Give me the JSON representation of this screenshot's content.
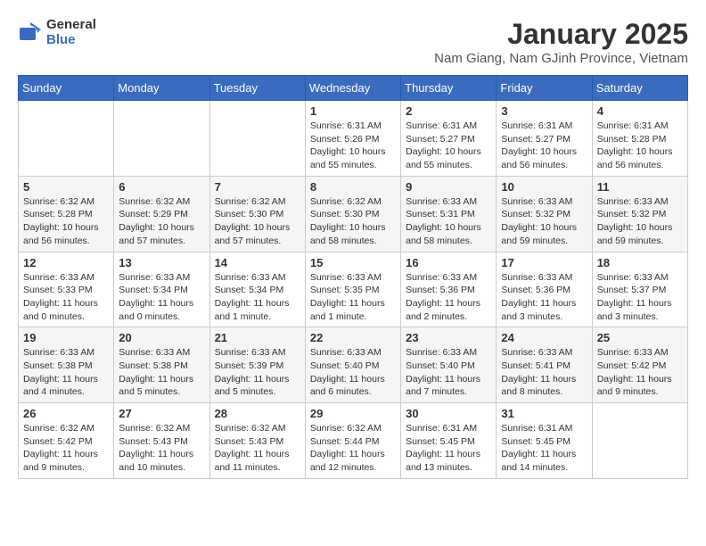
{
  "logo": {
    "general": "General",
    "blue": "Blue"
  },
  "title": {
    "month": "January 2025",
    "location": "Nam Giang, Nam GJinh Province, Vietnam"
  },
  "headers": [
    "Sunday",
    "Monday",
    "Tuesday",
    "Wednesday",
    "Thursday",
    "Friday",
    "Saturday"
  ],
  "weeks": [
    [
      {
        "day": "",
        "info": ""
      },
      {
        "day": "",
        "info": ""
      },
      {
        "day": "",
        "info": ""
      },
      {
        "day": "1",
        "info": "Sunrise: 6:31 AM\nSunset: 5:26 PM\nDaylight: 10 hours\nand 55 minutes."
      },
      {
        "day": "2",
        "info": "Sunrise: 6:31 AM\nSunset: 5:27 PM\nDaylight: 10 hours\nand 55 minutes."
      },
      {
        "day": "3",
        "info": "Sunrise: 6:31 AM\nSunset: 5:27 PM\nDaylight: 10 hours\nand 56 minutes."
      },
      {
        "day": "4",
        "info": "Sunrise: 6:31 AM\nSunset: 5:28 PM\nDaylight: 10 hours\nand 56 minutes."
      }
    ],
    [
      {
        "day": "5",
        "info": "Sunrise: 6:32 AM\nSunset: 5:28 PM\nDaylight: 10 hours\nand 56 minutes."
      },
      {
        "day": "6",
        "info": "Sunrise: 6:32 AM\nSunset: 5:29 PM\nDaylight: 10 hours\nand 57 minutes."
      },
      {
        "day": "7",
        "info": "Sunrise: 6:32 AM\nSunset: 5:30 PM\nDaylight: 10 hours\nand 57 minutes."
      },
      {
        "day": "8",
        "info": "Sunrise: 6:32 AM\nSunset: 5:30 PM\nDaylight: 10 hours\nand 58 minutes."
      },
      {
        "day": "9",
        "info": "Sunrise: 6:33 AM\nSunset: 5:31 PM\nDaylight: 10 hours\nand 58 minutes."
      },
      {
        "day": "10",
        "info": "Sunrise: 6:33 AM\nSunset: 5:32 PM\nDaylight: 10 hours\nand 59 minutes."
      },
      {
        "day": "11",
        "info": "Sunrise: 6:33 AM\nSunset: 5:32 PM\nDaylight: 10 hours\nand 59 minutes."
      }
    ],
    [
      {
        "day": "12",
        "info": "Sunrise: 6:33 AM\nSunset: 5:33 PM\nDaylight: 11 hours\nand 0 minutes."
      },
      {
        "day": "13",
        "info": "Sunrise: 6:33 AM\nSunset: 5:34 PM\nDaylight: 11 hours\nand 0 minutes."
      },
      {
        "day": "14",
        "info": "Sunrise: 6:33 AM\nSunset: 5:34 PM\nDaylight: 11 hours\nand 1 minute."
      },
      {
        "day": "15",
        "info": "Sunrise: 6:33 AM\nSunset: 5:35 PM\nDaylight: 11 hours\nand 1 minute."
      },
      {
        "day": "16",
        "info": "Sunrise: 6:33 AM\nSunset: 5:36 PM\nDaylight: 11 hours\nand 2 minutes."
      },
      {
        "day": "17",
        "info": "Sunrise: 6:33 AM\nSunset: 5:36 PM\nDaylight: 11 hours\nand 3 minutes."
      },
      {
        "day": "18",
        "info": "Sunrise: 6:33 AM\nSunset: 5:37 PM\nDaylight: 11 hours\nand 3 minutes."
      }
    ],
    [
      {
        "day": "19",
        "info": "Sunrise: 6:33 AM\nSunset: 5:38 PM\nDaylight: 11 hours\nand 4 minutes."
      },
      {
        "day": "20",
        "info": "Sunrise: 6:33 AM\nSunset: 5:38 PM\nDaylight: 11 hours\nand 5 minutes."
      },
      {
        "day": "21",
        "info": "Sunrise: 6:33 AM\nSunset: 5:39 PM\nDaylight: 11 hours\nand 5 minutes."
      },
      {
        "day": "22",
        "info": "Sunrise: 6:33 AM\nSunset: 5:40 PM\nDaylight: 11 hours\nand 6 minutes."
      },
      {
        "day": "23",
        "info": "Sunrise: 6:33 AM\nSunset: 5:40 PM\nDaylight: 11 hours\nand 7 minutes."
      },
      {
        "day": "24",
        "info": "Sunrise: 6:33 AM\nSunset: 5:41 PM\nDaylight: 11 hours\nand 8 minutes."
      },
      {
        "day": "25",
        "info": "Sunrise: 6:33 AM\nSunset: 5:42 PM\nDaylight: 11 hours\nand 9 minutes."
      }
    ],
    [
      {
        "day": "26",
        "info": "Sunrise: 6:32 AM\nSunset: 5:42 PM\nDaylight: 11 hours\nand 9 minutes."
      },
      {
        "day": "27",
        "info": "Sunrise: 6:32 AM\nSunset: 5:43 PM\nDaylight: 11 hours\nand 10 minutes."
      },
      {
        "day": "28",
        "info": "Sunrise: 6:32 AM\nSunset: 5:43 PM\nDaylight: 11 hours\nand 11 minutes."
      },
      {
        "day": "29",
        "info": "Sunrise: 6:32 AM\nSunset: 5:44 PM\nDaylight: 11 hours\nand 12 minutes."
      },
      {
        "day": "30",
        "info": "Sunrise: 6:31 AM\nSunset: 5:45 PM\nDaylight: 11 hours\nand 13 minutes."
      },
      {
        "day": "31",
        "info": "Sunrise: 6:31 AM\nSunset: 5:45 PM\nDaylight: 11 hours\nand 14 minutes."
      },
      {
        "day": "",
        "info": ""
      }
    ]
  ]
}
